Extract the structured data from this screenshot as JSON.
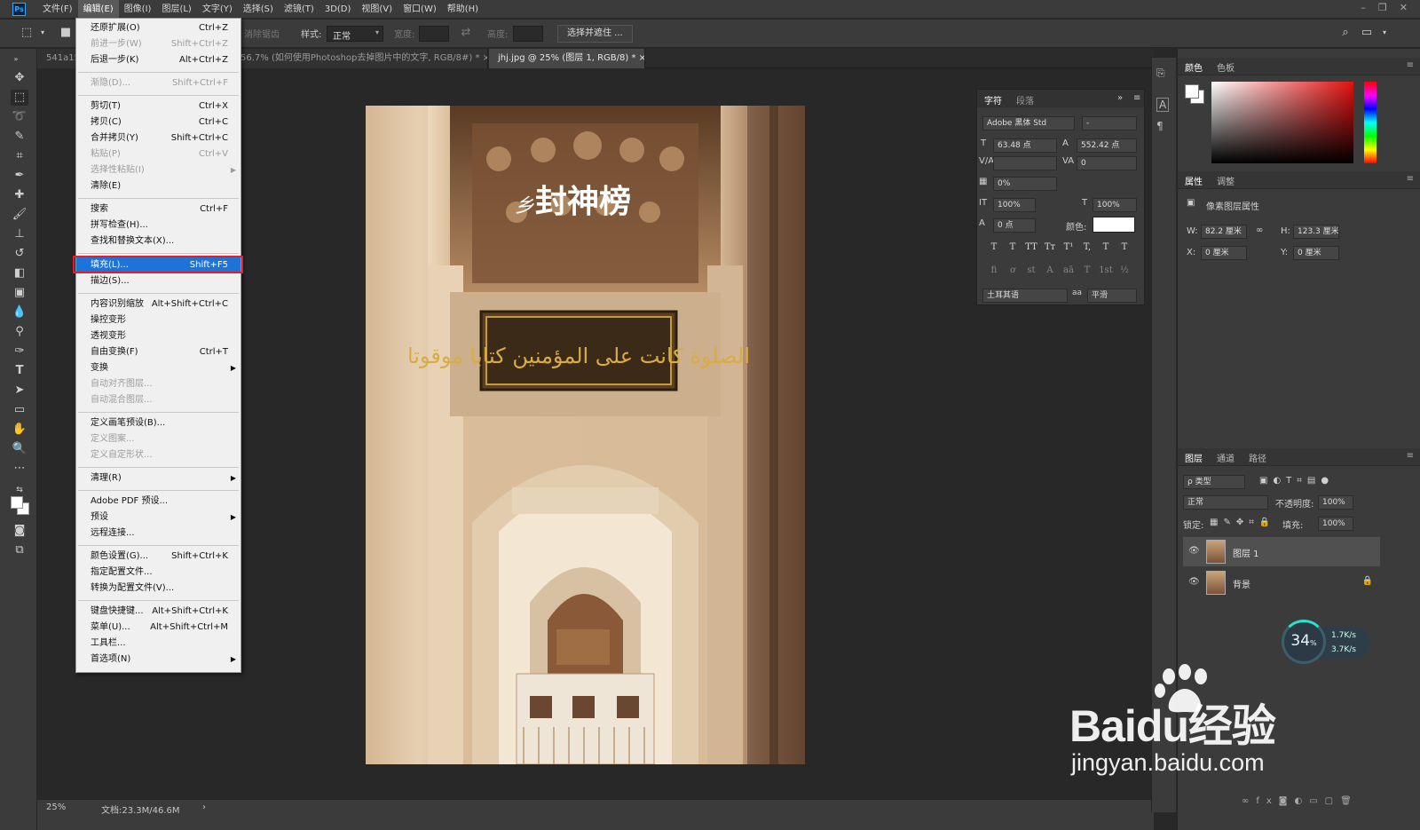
{
  "app": {
    "logo": "Ps"
  },
  "menubar": {
    "items": [
      "文件(F)",
      "编辑(E)",
      "图像(I)",
      "图层(L)",
      "文字(Y)",
      "选择(S)",
      "滤镜(T)",
      "3D(D)",
      "视图(V)",
      "窗口(W)",
      "帮助(H)"
    ],
    "active_index": 1
  },
  "options_bar": {
    "feather_label": "消除锯齿",
    "style_label": "样式:",
    "style_value": "正常",
    "width_label": "宽度:",
    "height_label": "高度:",
    "select_mask_button": "选择并遮住 ..."
  },
  "tabs": [
    {
      "label": "541a15",
      "active": false
    },
    {
      "label": "56.7% (如何使用Photoshop去掉图片中的文字, RGB/8#) *",
      "active": false
    },
    {
      "label": "jhj.jpg @ 25% (图层 1, RGB/8) *",
      "active": true
    }
  ],
  "tab_close": "×",
  "status_bar": {
    "zoom": "25%",
    "doc_info": "文档:23.3M/46.6M",
    "arrow": "›"
  },
  "document": {
    "overlay_text": "封神榜",
    "overlay_prefix": "乡",
    "calligraphy": "الصلوة كانت على المؤمنين كتابا موقوتا"
  },
  "edit_menu": {
    "items": [
      {
        "label": "还原扩展(O)",
        "shortcut": "Ctrl+Z",
        "disabled": false
      },
      {
        "label": "前进一步(W)",
        "shortcut": "Shift+Ctrl+Z",
        "disabled": true
      },
      {
        "label": "后退一步(K)",
        "shortcut": "Alt+Ctrl+Z",
        "disabled": false
      },
      {
        "sep": true
      },
      {
        "label": "渐隐(D)...",
        "shortcut": "Shift+Ctrl+F",
        "disabled": true
      },
      {
        "sep": true
      },
      {
        "label": "剪切(T)",
        "shortcut": "Ctrl+X",
        "disabled": false
      },
      {
        "label": "拷贝(C)",
        "shortcut": "Ctrl+C",
        "disabled": false
      },
      {
        "label": "合并拷贝(Y)",
        "shortcut": "Shift+Ctrl+C",
        "disabled": false
      },
      {
        "label": "粘贴(P)",
        "shortcut": "Ctrl+V",
        "disabled": true
      },
      {
        "label": "选择性粘贴(I)",
        "submenu": true,
        "disabled": true
      },
      {
        "label": "清除(E)",
        "disabled": false
      },
      {
        "sep": true
      },
      {
        "label": "搜索",
        "shortcut": "Ctrl+F",
        "disabled": false
      },
      {
        "label": "拼写检查(H)...",
        "disabled": false
      },
      {
        "label": "查找和替换文本(X)...",
        "disabled": false
      },
      {
        "sep": true
      },
      {
        "label": "填充(L)...",
        "shortcut": "Shift+F5",
        "highlighted": true
      },
      {
        "label": "描边(S)...",
        "disabled": false
      },
      {
        "sep": true
      },
      {
        "label": "内容识别缩放",
        "shortcut": "Alt+Shift+Ctrl+C",
        "disabled": false
      },
      {
        "label": "操控变形",
        "disabled": false
      },
      {
        "label": "透视变形",
        "disabled": false
      },
      {
        "label": "自由变换(F)",
        "shortcut": "Ctrl+T",
        "disabled": false
      },
      {
        "label": "变换",
        "submenu": true,
        "disabled": false
      },
      {
        "label": "自动对齐图层...",
        "disabled": true
      },
      {
        "label": "自动混合图层...",
        "disabled": true
      },
      {
        "sep": true
      },
      {
        "label": "定义画笔预设(B)...",
        "disabled": false
      },
      {
        "label": "定义图案...",
        "disabled": true
      },
      {
        "label": "定义自定形状...",
        "disabled": true
      },
      {
        "sep": true
      },
      {
        "label": "清理(R)",
        "submenu": true,
        "disabled": false
      },
      {
        "sep": true
      },
      {
        "label": "Adobe PDF 预设...",
        "disabled": false
      },
      {
        "label": "预设",
        "submenu": true,
        "disabled": false
      },
      {
        "label": "远程连接...",
        "disabled": false
      },
      {
        "sep": true
      },
      {
        "label": "颜色设置(G)...",
        "shortcut": "Shift+Ctrl+K",
        "disabled": false
      },
      {
        "label": "指定配置文件...",
        "disabled": false
      },
      {
        "label": "转换为配置文件(V)...",
        "disabled": false
      },
      {
        "sep": true
      },
      {
        "label": "键盘快捷键...",
        "shortcut": "Alt+Shift+Ctrl+K",
        "disabled": false
      },
      {
        "label": "菜单(U)...",
        "shortcut": "Alt+Shift+Ctrl+M",
        "disabled": false
      },
      {
        "label": "工具栏...",
        "disabled": false
      },
      {
        "label": "首选项(N)",
        "submenu": true,
        "disabled": false
      }
    ]
  },
  "character_panel": {
    "tab_character": "字符",
    "tab_paragraph": "段落",
    "font_family": "Adobe 黑体 Std",
    "font_style": "-",
    "size": "63.48 点",
    "leading": "552.42 点",
    "tracking": "0",
    "scale_percent": "0%",
    "vscale": "100%",
    "hscale": "100%",
    "baseline": "0 点",
    "color_label": "颜色:",
    "language": "土耳其语",
    "antialias_label": "aa",
    "antialias": "平滑",
    "style_buttons": [
      "T",
      "T",
      "TT",
      "Tт",
      "T¹",
      "T,",
      "T",
      "T"
    ],
    "opentype_buttons": [
      "fi",
      "ơ",
      "st",
      "A",
      "aā",
      "T",
      "1st",
      "½"
    ]
  },
  "color_panel": {
    "tab_color": "颜色",
    "tab_swatches": "色板"
  },
  "properties_panel": {
    "tab_properties": "属性",
    "tab_adjustments": "调整",
    "subtitle": "像素图层属性",
    "w_label": "W:",
    "w": "82.2 厘米",
    "h_label": "H:",
    "h": "123.3 厘米",
    "x_label": "X:",
    "x": "0 厘米",
    "y_label": "Y:",
    "y": "0 厘米"
  },
  "layers_panel": {
    "tab_layers": "图层",
    "tab_channels": "通道",
    "tab_paths": "路径",
    "filter_kind": "ρ 类型",
    "blend_mode": "正常",
    "opacity_label": "不透明度:",
    "opacity": "100%",
    "lock_label": "锁定:",
    "fill_label": "填充:",
    "fill": "100%",
    "layers": [
      {
        "name": "图层 1",
        "selected": true,
        "locked": false
      },
      {
        "name": "背景",
        "selected": false,
        "locked": true
      }
    ]
  },
  "net_widget": {
    "percent": "34",
    "percent_unit": "%",
    "up": "1.7",
    "down": "3.7",
    "unit": "K/s"
  },
  "watermark": {
    "brand_a": "Bai",
    "brand_b": "du",
    "brand_c": "经验",
    "domain": "jingyan.baidu.com"
  },
  "colors": {
    "menu_highlight": "#1e73d8",
    "annotation_box": "#e31e24",
    "panel_bg": "#3b3b3b",
    "canvas_bg": "#282828"
  }
}
